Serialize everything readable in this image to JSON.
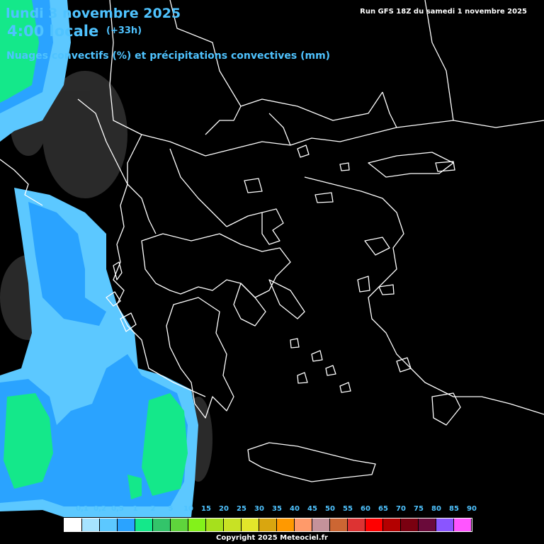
{
  "header": {
    "date": "lundi 3 novembre 2025",
    "time": "4:00 locale",
    "lead": "(+33h)",
    "field": "Nuages convectifs (%) et précipitations convectives (mm)",
    "run": "Run GFS 18Z du samedi 1 novembre 2025"
  },
  "legend": {
    "labels": [
      "0,1",
      "0,2",
      "0,5",
      "1",
      "2",
      "5",
      "10",
      "15",
      "20",
      "25",
      "30",
      "35",
      "40",
      "45",
      "50",
      "55",
      "60",
      "65",
      "70",
      "75",
      "80",
      "85",
      "90"
    ],
    "colors": [
      "#ffffff",
      "#a6e3ff",
      "#5cc8ff",
      "#2aa3ff",
      "#14e88a",
      "#33c46a",
      "#5fd43c",
      "#83f21a",
      "#a6e01c",
      "#c8e224",
      "#e2e62a",
      "#d9a60f",
      "#ff9900",
      "#ff9a6a",
      "#c4929a",
      "#cc6633",
      "#dd3333",
      "#ff0000",
      "#b30000",
      "#7a0010",
      "#6a0a3a",
      "#8a55ff",
      "#ff55ff"
    ]
  },
  "copyright": "Copyright 2025 Meteociel.fr"
}
